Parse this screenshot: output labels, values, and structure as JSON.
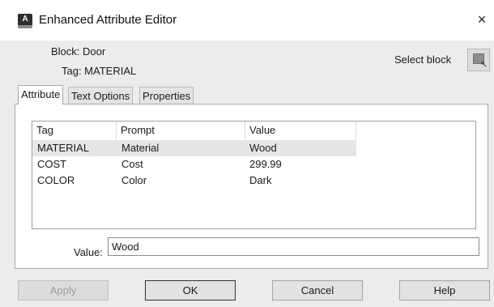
{
  "window": {
    "title": "Enhanced Attribute Editor",
    "close_label": "×"
  },
  "header": {
    "block_text": "Block: Door",
    "tag_text": "Tag: MATERIAL",
    "select_block_label": "Select block",
    "select_block_icon": "select-block-icon"
  },
  "tabs": [
    {
      "label": "Attribute",
      "active": true
    },
    {
      "label": "Text Options",
      "active": false
    },
    {
      "label": "Properties",
      "active": false
    }
  ],
  "attributes": {
    "columns": [
      "Tag",
      "Prompt",
      "Value"
    ],
    "rows": [
      {
        "tag": "MATERIAL",
        "prompt": "Material",
        "value": "Wood",
        "selected": true
      },
      {
        "tag": "COST",
        "prompt": "Cost",
        "value": "299.99",
        "selected": false
      },
      {
        "tag": "COLOR",
        "prompt": "Color",
        "value": "Dark",
        "selected": false
      }
    ]
  },
  "value_field": {
    "label": "Value:",
    "value": "Wood"
  },
  "buttons": {
    "apply": "Apply",
    "ok": "OK",
    "cancel": "Cancel",
    "help": "Help"
  }
}
